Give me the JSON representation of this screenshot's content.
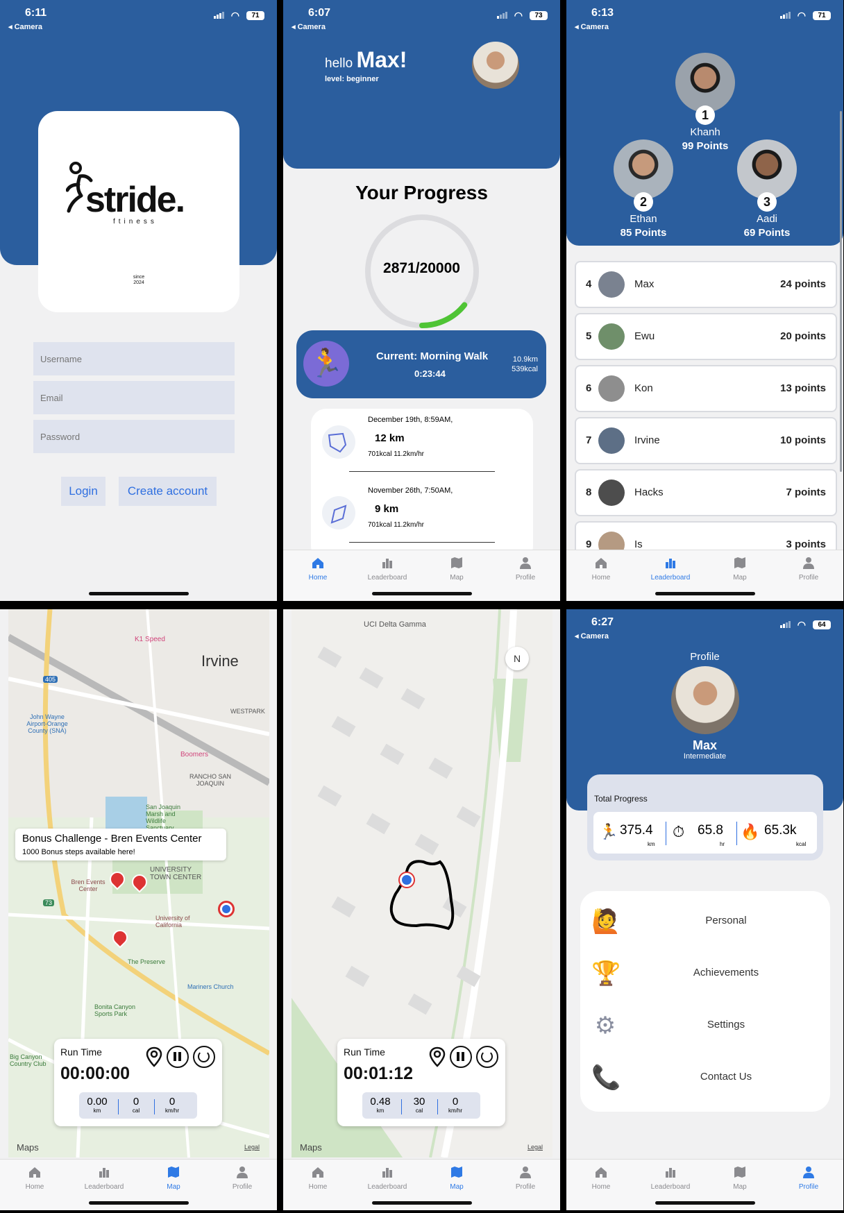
{
  "status": {
    "p1": {
      "time": "6:11",
      "back": "◂ Camera",
      "battery": "71"
    },
    "p2": {
      "time": "6:07",
      "back": "◂ Camera",
      "battery": "73"
    },
    "p3": {
      "time": "6:13",
      "back": "◂ Camera",
      "battery": "71"
    },
    "p6": {
      "time": "6:27",
      "back": "◂ Camera",
      "battery": "64"
    }
  },
  "login": {
    "brand": "stride.",
    "tagline": "ftiness",
    "since": "since",
    "year": "2024",
    "username_placeholder": "Username",
    "email_placeholder": "Email",
    "password_placeholder": "Password",
    "login_label": "Login",
    "create_label": "Create account"
  },
  "home": {
    "hello": "hello",
    "name": "Max!",
    "level": "level: beginner",
    "progress_title": "Your Progress",
    "progress_value": "2871/20000",
    "progress_fraction": 0.1436,
    "current_label": "Current: Morning Walk",
    "current_time": "0:23:44",
    "current_km": "10.9km",
    "current_kcal": "539kcal",
    "activities": [
      {
        "date": "December 19th, 8:59AM,",
        "distance": "12 km",
        "stats": "701kcal 11.2km/hr"
      },
      {
        "date": "November 26th, 7:50AM,",
        "distance": "9 km",
        "stats": "701kcal 11.2km/hr"
      }
    ]
  },
  "leaderboard": {
    "podium": [
      {
        "rank": "1",
        "name": "Khanh",
        "points": "99 Points"
      },
      {
        "rank": "2",
        "name": "Ethan",
        "points": "85 Points"
      },
      {
        "rank": "3",
        "name": "Aadi",
        "points": "69 Points"
      }
    ],
    "rows": [
      {
        "rank": "4",
        "name": "Max",
        "points": "24 points"
      },
      {
        "rank": "5",
        "name": "Ewu",
        "points": "20 points"
      },
      {
        "rank": "6",
        "name": "Kon",
        "points": "13 points"
      },
      {
        "rank": "7",
        "name": "Irvine",
        "points": "10 points"
      },
      {
        "rank": "8",
        "name": "Hacks",
        "points": "7 points"
      },
      {
        "rank": "9",
        "name": "Is",
        "points": "3 points"
      }
    ]
  },
  "tabs": [
    "Home",
    "Leaderboard",
    "Map",
    "Profile"
  ],
  "map1": {
    "labels": {
      "irvine": "Irvine",
      "k1": "K1 Speed",
      "westpark": "WESTPARK",
      "rancho": "RANCHO SAN JOAQUIN",
      "airport": "John Wayne Airport-Orange County (SNA)",
      "boomers": "Boomers",
      "sanjoaquin": "San Joaquin Marsh and Wildlife Sanctuary",
      "utc": "UNIVERSITY TOWN CENTER",
      "bren": "Bren Events Center",
      "uci": "University of California",
      "preserve": "The Preserve",
      "mariners": "Mariners Church",
      "bonita": "Bonita Canyon Sports Park",
      "bigcanyon": "Big Canyon Country Club",
      "maps": "Maps",
      "legal": "Legal",
      "hwy405": "405",
      "hwy73": "73"
    },
    "callout_title": "Bonus Challenge - Bren Events Center",
    "callout_sub": "1000 Bonus steps available here!",
    "run_label": "Run Time",
    "run_time": "00:00:00",
    "stats": [
      {
        "v": "0.00",
        "u": "km"
      },
      {
        "v": "0",
        "u": "cal"
      },
      {
        "v": "0",
        "u": "km/hr"
      }
    ]
  },
  "map2": {
    "place": "UCI Delta Gamma",
    "compass": "N",
    "maps": "Maps",
    "legal": "Legal",
    "run_label": "Run Time",
    "run_time": "00:01:12",
    "stats": [
      {
        "v": "0.48",
        "u": "km"
      },
      {
        "v": "30",
        "u": "cal"
      },
      {
        "v": "0",
        "u": "km/hr"
      }
    ]
  },
  "profile": {
    "title": "Profile",
    "name": "Max",
    "level": "Intermediate",
    "total_label": "Total Progress",
    "stats": [
      {
        "v": "375.4",
        "u": "km"
      },
      {
        "v": "65.8",
        "u": "hr"
      },
      {
        "v": "65.3k",
        "u": "kcal"
      }
    ],
    "menu": [
      {
        "label": "Personal",
        "icon": "🙋"
      },
      {
        "label": "Achievements",
        "icon": "🏆"
      },
      {
        "label": "Settings",
        "icon": "⚙"
      },
      {
        "label": "Contact Us",
        "icon": "📞"
      }
    ]
  },
  "colors": {
    "brand_blue": "#2b5e9e",
    "accent_green": "#4fc435",
    "tab_active": "#2f7ae5"
  }
}
